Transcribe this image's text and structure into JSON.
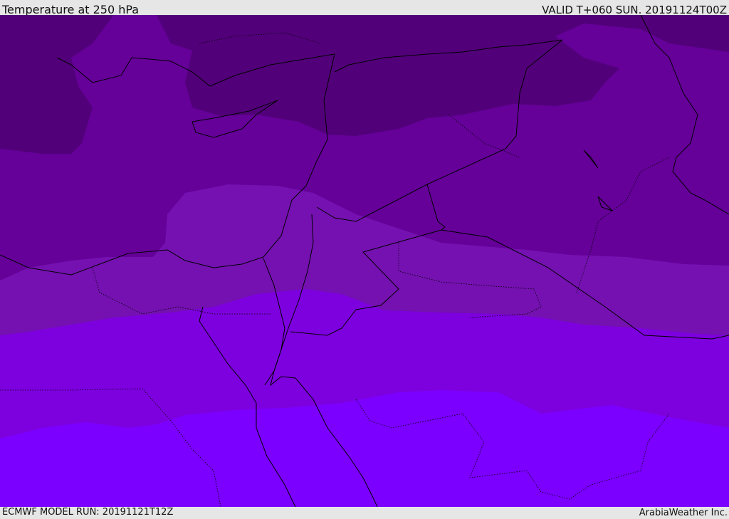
{
  "header": {
    "title": "Temperature at 250 hPa",
    "valid": "VALID T+060 SUN. 20191124T00Z"
  },
  "footer": {
    "model_run": "ECMWF MODEL RUN: 20191121T12Z",
    "credit": "ArabiaWeather Inc."
  },
  "map": {
    "region": "Eastern Mediterranean / Middle East",
    "band_colors": [
      "#52007a",
      "#650099",
      "#7411b0",
      "#7d00de",
      "#7b00ff"
    ],
    "coast_color": "#000000"
  }
}
